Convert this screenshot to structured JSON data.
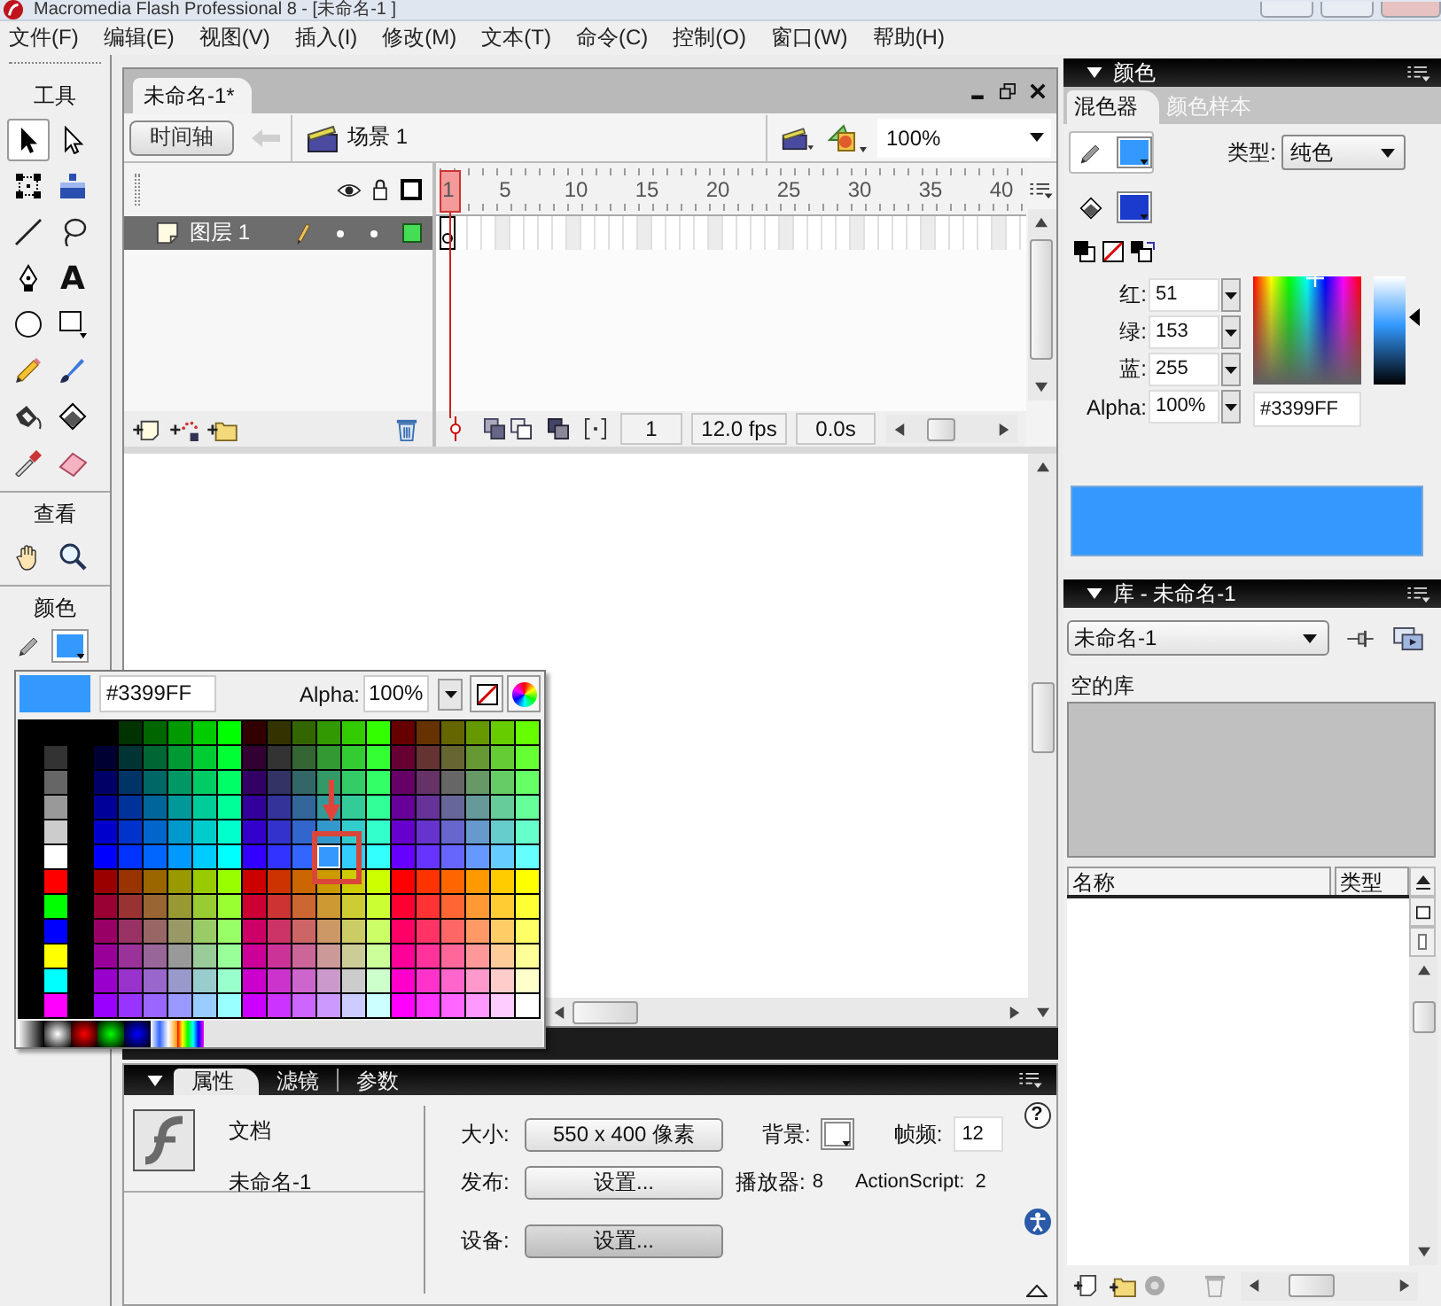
{
  "title_bar": {
    "title": "Macromedia Flash Professional 8 - [未命名-1 ]"
  },
  "menu_bar": [
    "文件(F)",
    "编辑(E)",
    "视图(V)",
    "插入(I)",
    "修改(M)",
    "文本(T)",
    "命令(C)",
    "控制(O)",
    "窗口(W)",
    "帮助(H)"
  ],
  "tools_panel": {
    "title": "工具",
    "tools": [
      {
        "kind": "selection",
        "selected": true
      },
      {
        "kind": "subselection",
        "selected": false
      },
      {
        "kind": "free-transform",
        "selected": false
      },
      {
        "kind": "fill-transform",
        "selected": false
      },
      {
        "kind": "line",
        "selected": false
      },
      {
        "kind": "lasso",
        "selected": false
      },
      {
        "kind": "pen",
        "selected": false
      },
      {
        "kind": "text",
        "glyph": "A",
        "selected": false
      },
      {
        "kind": "oval",
        "selected": false
      },
      {
        "kind": "rectangle",
        "selected": false
      },
      {
        "kind": "pencil",
        "selected": false
      },
      {
        "kind": "brush",
        "selected": false
      },
      {
        "kind": "ink-bottle",
        "selected": false
      },
      {
        "kind": "paint-bucket",
        "selected": false
      },
      {
        "kind": "eyedropper",
        "selected": false
      },
      {
        "kind": "eraser",
        "selected": false
      }
    ],
    "view_title": "查看",
    "view_tools": [
      {
        "kind": "hand",
        "selected": false
      },
      {
        "kind": "zoom",
        "selected": false
      }
    ],
    "color_title": "颜色",
    "stroke_color": {
      "color": "#3399ff"
    }
  },
  "document": {
    "tab": {
      "label": "未命名-1*",
      "selected": true
    },
    "toolbar": {
      "timeline_button": "时间轴",
      "back_button": {
        "disabled": true
      },
      "scene": "场景 1",
      "zoom": "100%"
    },
    "timeline": {
      "layers": [
        {
          "name": "图层 1",
          "selected": true,
          "visible": true,
          "locked": false,
          "color": "#44dd55"
        }
      ],
      "frame_numbers": [
        "1",
        "5",
        "10",
        "15",
        "20",
        "25",
        "30",
        "35",
        "40"
      ],
      "current_frame": "1",
      "frame_rate": "12.0 fps",
      "elapsed_time": "0.0s"
    }
  },
  "color_popup": {
    "color": "#3399ff",
    "hex": "#3399FF",
    "alpha_label": "Alpha:",
    "alpha": "100%",
    "swatch_grid": {
      "gray_column": [
        {
          "selected": false
        },
        {
          "selected": false
        },
        {
          "selected": false
        },
        {
          "selected": false
        },
        {
          "selected": false
        },
        {
          "selected": false
        },
        {
          "selected": false
        },
        {
          "selected": false
        },
        {
          "selected": false
        },
        {
          "selected": false
        },
        {
          "selected": false
        }
      ],
      "rows": [
        {
          "swatches": [
            {
              "selected": false
            },
            {
              "selected": false
            },
            {
              "selected": false
            },
            {
              "selected": false
            },
            {
              "selected": false
            },
            {
              "selected": false
            },
            {
              "selected": false
            },
            {
              "selected": false
            },
            {
              "selected": false
            },
            {
              "selected": false
            },
            {
              "selected": false
            },
            {
              "selected": false
            },
            {
              "selected": false
            },
            {
              "selected": false
            },
            {
              "selected": false
            },
            {
              "selected": false
            },
            {
              "selected": false
            }
          ]
        },
        {
          "swatches": [
            {
              "selected": false
            },
            {
              "selected": false
            },
            {
              "selected": false
            },
            {
              "selected": false
            },
            {
              "selected": false
            },
            {
              "selected": false
            },
            {
              "selected": false
            },
            {
              "selected": false
            },
            {
              "selected": false
            },
            {
              "selected": false
            },
            {
              "selected": false
            },
            {
              "selected": false
            },
            {
              "selected": false
            },
            {
              "selected": false
            },
            {
              "selected": false
            },
            {
              "selected": false
            },
            {
              "selected": false
            },
            {
              "selected": false
            }
          ]
        },
        {
          "swatches": [
            {
              "selected": false
            },
            {
              "selected": false
            },
            {
              "selected": false
            },
            {
              "selected": false
            },
            {
              "selected": false
            },
            {
              "selected": false
            },
            {
              "selected": false
            },
            {
              "selected": false
            },
            {
              "selected": false
            },
            {
              "selected": false
            },
            {
              "selected": false
            },
            {
              "selected": false
            },
            {
              "selected": false
            },
            {
              "selected": false
            },
            {
              "selected": false
            },
            {
              "selected": false
            },
            {
              "selected": false
            },
            {
              "selected": false
            }
          ]
        },
        {
          "swatches": [
            {
              "selected": false
            },
            {
              "selected": false
            },
            {
              "selected": false
            },
            {
              "selected": false
            },
            {
              "selected": false
            },
            {
              "selected": false
            },
            {
              "selected": false
            },
            {
              "selected": false
            },
            {
              "selected": false
            },
            {
              "selected": false
            },
            {
              "selected": false
            },
            {
              "selected": false
            },
            {
              "selected": false
            },
            {
              "selected": false
            },
            {
              "selected": false
            },
            {
              "selected": false
            },
            {
              "selected": false
            },
            {
              "selected": false
            }
          ]
        },
        {
          "swatches": [
            {
              "selected": false
            },
            {
              "selected": false
            },
            {
              "selected": false
            },
            {
              "selected": false
            },
            {
              "selected": false
            },
            {
              "selected": false
            },
            {
              "selected": false
            },
            {
              "selected": false
            },
            {
              "selected": false
            },
            {
              "selected": false
            },
            {
              "selected": false
            },
            {
              "selected": false
            },
            {
              "selected": false
            },
            {
              "selected": false
            },
            {
              "selected": false
            },
            {
              "selected": false
            },
            {
              "selected": false
            },
            {
              "selected": false
            }
          ]
        },
        {
          "swatches": [
            {
              "selected": false
            },
            {
              "selected": false
            },
            {
              "selected": false
            },
            {
              "selected": false
            },
            {
              "selected": false
            },
            {
              "selected": false
            },
            {
              "selected": false
            },
            {
              "selected": false
            },
            {
              "selected": false
            },
            {
              "selected": true
            },
            {
              "selected": false
            },
            {
              "selected": false
            },
            {
              "selected": false
            },
            {
              "selected": false
            },
            {
              "selected": false
            },
            {
              "selected": false
            },
            {
              "selected": false
            },
            {
              "selected": false
            }
          ]
        },
        {
          "swatches": [
            {
              "selected": false
            },
            {
              "selected": false
            },
            {
              "selected": false
            },
            {
              "selected": false
            },
            {
              "selected": false
            },
            {
              "selected": false
            },
            {
              "selected": false
            },
            {
              "selected": false
            },
            {
              "selected": false
            },
            {
              "selected": false
            },
            {
              "selected": false
            },
            {
              "selected": false
            },
            {
              "selected": false
            },
            {
              "selected": false
            },
            {
              "selected": false
            },
            {
              "selected": false
            },
            {
              "selected": false
            },
            {
              "selected": false
            }
          ]
        },
        {
          "swatches": [
            {
              "selected": false
            },
            {
              "selected": false
            },
            {
              "selected": false
            },
            {
              "selected": false
            },
            {
              "selected": false
            },
            {
              "selected": false
            },
            {
              "selected": false
            },
            {
              "selected": false
            },
            {
              "selected": false
            },
            {
              "selected": false
            },
            {
              "selected": false
            },
            {
              "selected": false
            },
            {
              "selected": false
            },
            {
              "selected": false
            },
            {
              "selected": false
            },
            {
              "selected": false
            },
            {
              "selected": false
            },
            {
              "selected": false
            }
          ]
        },
        {
          "swatches": [
            {
              "selected": false
            },
            {
              "selected": false
            },
            {
              "selected": false
            },
            {
              "selected": false
            },
            {
              "selected": false
            },
            {
              "selected": false
            },
            {
              "selected": false
            },
            {
              "selected": false
            },
            {
              "selected": false
            },
            {
              "selected": false
            },
            {
              "selected": false
            },
            {
              "selected": false
            },
            {
              "selected": false
            },
            {
              "selected": false
            },
            {
              "selected": false
            },
            {
              "selected": false
            },
            {
              "selected": false
            },
            {
              "selected": false
            }
          ]
        },
        {
          "swatches": [
            {
              "selected": false
            },
            {
              "selected": false
            },
            {
              "selected": false
            },
            {
              "selected": false
            },
            {
              "selected": false
            },
            {
              "selected": false
            },
            {
              "selected": false
            },
            {
              "selected": false
            },
            {
              "selected": false
            },
            {
              "selected": false
            },
            {
              "selected": false
            },
            {
              "selected": false
            },
            {
              "selected": false
            },
            {
              "selected": false
            },
            {
              "selected": false
            },
            {
              "selected": false
            },
            {
              "selected": false
            },
            {
              "selected": false
            }
          ]
        },
        {
          "swatches": [
            {
              "selected": false
            },
            {
              "selected": false
            },
            {
              "selected": false
            },
            {
              "selected": false
            },
            {
              "selected": false
            },
            {
              "selected": false
            },
            {
              "selected": false
            },
            {
              "selected": false
            },
            {
              "selected": false
            },
            {
              "selected": false
            },
            {
              "selected": false
            },
            {
              "selected": false
            },
            {
              "selected": false
            },
            {
              "selected": false
            },
            {
              "selected": false
            },
            {
              "selected": false
            },
            {
              "selected": false
            },
            {
              "selected": false
            }
          ]
        },
        {
          "swatches": [
            {
              "selected": false
            },
            {
              "selected": false
            },
            {
              "selected": false
            },
            {
              "selected": false
            },
            {
              "selected": false
            },
            {
              "selected": false
            },
            {
              "selected": false
            },
            {
              "selected": false
            },
            {
              "selected": false
            },
            {
              "selected": false
            },
            {
              "selected": false
            },
            {
              "selected": false
            },
            {
              "selected": false
            },
            {
              "selected": false
            },
            {
              "selected": false
            },
            {
              "selected": false
            },
            {
              "selected": false
            },
            {
              "selected": false
            }
          ]
        }
      ]
    }
  },
  "properties_panel": {
    "tabs": [
      {
        "label": "属性",
        "selected": true
      },
      {
        "label": "滤镜",
        "selected": false
      },
      {
        "label": "参数",
        "selected": false
      }
    ],
    "doc_type": "文档",
    "doc_name": "未命名-1",
    "size_label": "大小:",
    "size_button": "550 x 400 像素",
    "background_label": "背景:",
    "background": {
      "color": "#ffffff"
    },
    "frame_rate_label": "帧频:",
    "frame_rate": "12",
    "help": "?",
    "publish_label": "发布:",
    "publish_button": "设置...",
    "player_label": "播放器:",
    "player": "8",
    "actionscript_label": "ActionScript:",
    "actionscript": "2",
    "device_label": "设备:",
    "device_button": "设置..."
  },
  "color_panel": {
    "title": "颜色",
    "tabs": [
      {
        "label": "混色器",
        "selected": true
      },
      {
        "label": "颜色样本",
        "selected": false
      }
    ],
    "stroke": {
      "color": "#3399ff",
      "selected": true
    },
    "fill": {
      "color": "#1a3bcc",
      "selected": false
    },
    "type_label": "类型:",
    "type": "纯色",
    "channels": [
      {
        "label": "红:",
        "value": "51"
      },
      {
        "label": "绿:",
        "value": "153"
      },
      {
        "label": "蓝:",
        "value": "255"
      },
      {
        "label": "Alpha:",
        "value": "100%"
      }
    ],
    "hue_picker": {
      "level": 0.58
    },
    "brightness": {
      "level": 0.62
    },
    "hex": "#3399FF",
    "preview": {
      "color": "#3399ff"
    }
  },
  "library_panel": {
    "title": "库 - 未命名-1",
    "document": "未命名-1",
    "status": "空的库",
    "columns": [
      "名称",
      "类型"
    ]
  }
}
